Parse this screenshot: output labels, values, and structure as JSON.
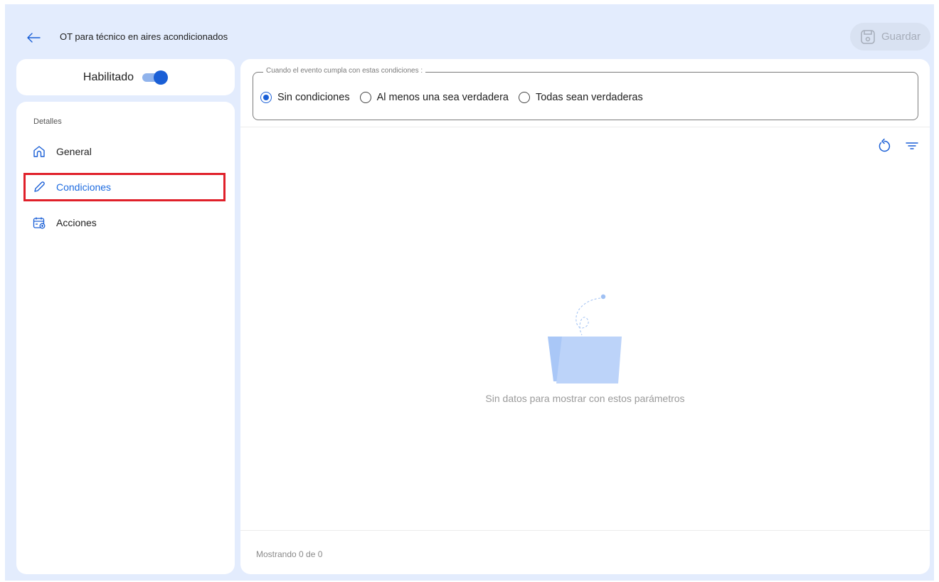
{
  "header": {
    "title": "OT para técnico en aires acondicionados",
    "save_label": "Guardar"
  },
  "sidebar": {
    "toggle_label": "Habilitado",
    "toggle_on": true,
    "section_label": "Detalles",
    "items": [
      {
        "label": "General",
        "icon": "home-icon",
        "active": false
      },
      {
        "label": "Condiciones",
        "icon": "pencil-icon",
        "active": true
      },
      {
        "label": "Acciones",
        "icon": "calendar-add-icon",
        "active": false
      }
    ]
  },
  "conditions": {
    "legend": "Cuando el evento cumpla con estas condiciones :",
    "options": [
      {
        "label": "Sin condiciones",
        "selected": true
      },
      {
        "label": "Al menos una sea verdadera",
        "selected": false
      },
      {
        "label": "Todas sean verdaderas",
        "selected": false
      }
    ]
  },
  "toolbar": {
    "refresh_icon": "refresh-icon",
    "filter_icon": "filter-icon"
  },
  "empty_state": {
    "message": "Sin datos para mostrar con estos parámetros",
    "icon": "empty-folder-icon"
  },
  "footer": {
    "showing": "Mostrando 0 de 0"
  },
  "colors": {
    "accent": "#1a5fd6",
    "background": "#e3ecfd",
    "highlight_border": "#e0202a"
  }
}
